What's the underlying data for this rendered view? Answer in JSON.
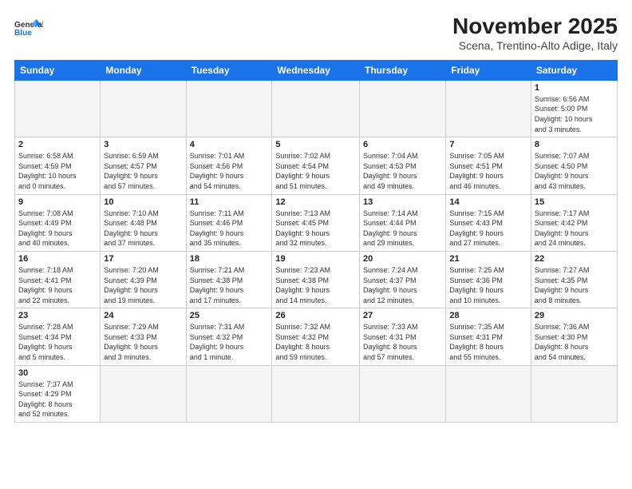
{
  "logo": {
    "line1": "General",
    "line2": "Blue"
  },
  "title": "November 2025",
  "subtitle": "Scena, Trentino-Alto Adige, Italy",
  "days_of_week": [
    "Sunday",
    "Monday",
    "Tuesday",
    "Wednesday",
    "Thursday",
    "Friday",
    "Saturday"
  ],
  "weeks": [
    [
      {
        "day": "",
        "info": "",
        "empty": true
      },
      {
        "day": "",
        "info": "",
        "empty": true
      },
      {
        "day": "",
        "info": "",
        "empty": true
      },
      {
        "day": "",
        "info": "",
        "empty": true
      },
      {
        "day": "",
        "info": "",
        "empty": true
      },
      {
        "day": "",
        "info": "",
        "empty": true
      },
      {
        "day": "1",
        "info": "Sunrise: 6:56 AM\nSunset: 5:00 PM\nDaylight: 10 hours\nand 3 minutes."
      }
    ],
    [
      {
        "day": "2",
        "info": "Sunrise: 6:58 AM\nSunset: 4:59 PM\nDaylight: 10 hours\nand 0 minutes."
      },
      {
        "day": "3",
        "info": "Sunrise: 6:59 AM\nSunset: 4:57 PM\nDaylight: 9 hours\nand 57 minutes."
      },
      {
        "day": "4",
        "info": "Sunrise: 7:01 AM\nSunset: 4:56 PM\nDaylight: 9 hours\nand 54 minutes."
      },
      {
        "day": "5",
        "info": "Sunrise: 7:02 AM\nSunset: 4:54 PM\nDaylight: 9 hours\nand 51 minutes."
      },
      {
        "day": "6",
        "info": "Sunrise: 7:04 AM\nSunset: 4:53 PM\nDaylight: 9 hours\nand 49 minutes."
      },
      {
        "day": "7",
        "info": "Sunrise: 7:05 AM\nSunset: 4:51 PM\nDaylight: 9 hours\nand 46 minutes."
      },
      {
        "day": "8",
        "info": "Sunrise: 7:07 AM\nSunset: 4:50 PM\nDaylight: 9 hours\nand 43 minutes."
      }
    ],
    [
      {
        "day": "9",
        "info": "Sunrise: 7:08 AM\nSunset: 4:49 PM\nDaylight: 9 hours\nand 40 minutes."
      },
      {
        "day": "10",
        "info": "Sunrise: 7:10 AM\nSunset: 4:48 PM\nDaylight: 9 hours\nand 37 minutes."
      },
      {
        "day": "11",
        "info": "Sunrise: 7:11 AM\nSunset: 4:46 PM\nDaylight: 9 hours\nand 35 minutes."
      },
      {
        "day": "12",
        "info": "Sunrise: 7:13 AM\nSunset: 4:45 PM\nDaylight: 9 hours\nand 32 minutes."
      },
      {
        "day": "13",
        "info": "Sunrise: 7:14 AM\nSunset: 4:44 PM\nDaylight: 9 hours\nand 29 minutes."
      },
      {
        "day": "14",
        "info": "Sunrise: 7:15 AM\nSunset: 4:43 PM\nDaylight: 9 hours\nand 27 minutes."
      },
      {
        "day": "15",
        "info": "Sunrise: 7:17 AM\nSunset: 4:42 PM\nDaylight: 9 hours\nand 24 minutes."
      }
    ],
    [
      {
        "day": "16",
        "info": "Sunrise: 7:18 AM\nSunset: 4:41 PM\nDaylight: 9 hours\nand 22 minutes."
      },
      {
        "day": "17",
        "info": "Sunrise: 7:20 AM\nSunset: 4:39 PM\nDaylight: 9 hours\nand 19 minutes."
      },
      {
        "day": "18",
        "info": "Sunrise: 7:21 AM\nSunset: 4:38 PM\nDaylight: 9 hours\nand 17 minutes."
      },
      {
        "day": "19",
        "info": "Sunrise: 7:23 AM\nSunset: 4:38 PM\nDaylight: 9 hours\nand 14 minutes."
      },
      {
        "day": "20",
        "info": "Sunrise: 7:24 AM\nSunset: 4:37 PM\nDaylight: 9 hours\nand 12 minutes."
      },
      {
        "day": "21",
        "info": "Sunrise: 7:25 AM\nSunset: 4:36 PM\nDaylight: 9 hours\nand 10 minutes."
      },
      {
        "day": "22",
        "info": "Sunrise: 7:27 AM\nSunset: 4:35 PM\nDaylight: 9 hours\nand 8 minutes."
      }
    ],
    [
      {
        "day": "23",
        "info": "Sunrise: 7:28 AM\nSunset: 4:34 PM\nDaylight: 9 hours\nand 5 minutes."
      },
      {
        "day": "24",
        "info": "Sunrise: 7:29 AM\nSunset: 4:33 PM\nDaylight: 9 hours\nand 3 minutes."
      },
      {
        "day": "25",
        "info": "Sunrise: 7:31 AM\nSunset: 4:32 PM\nDaylight: 9 hours\nand 1 minute."
      },
      {
        "day": "26",
        "info": "Sunrise: 7:32 AM\nSunset: 4:32 PM\nDaylight: 8 hours\nand 59 minutes."
      },
      {
        "day": "27",
        "info": "Sunrise: 7:33 AM\nSunset: 4:31 PM\nDaylight: 8 hours\nand 57 minutes."
      },
      {
        "day": "28",
        "info": "Sunrise: 7:35 AM\nSunset: 4:31 PM\nDaylight: 8 hours\nand 55 minutes."
      },
      {
        "day": "29",
        "info": "Sunrise: 7:36 AM\nSunset: 4:30 PM\nDaylight: 8 hours\nand 54 minutes."
      }
    ],
    [
      {
        "day": "30",
        "info": "Sunrise: 7:37 AM\nSunset: 4:29 PM\nDaylight: 8 hours\nand 52 minutes."
      },
      {
        "day": "",
        "info": "",
        "empty": true
      },
      {
        "day": "",
        "info": "",
        "empty": true
      },
      {
        "day": "",
        "info": "",
        "empty": true
      },
      {
        "day": "",
        "info": "",
        "empty": true
      },
      {
        "day": "",
        "info": "",
        "empty": true
      },
      {
        "day": "",
        "info": "",
        "empty": true
      }
    ]
  ]
}
